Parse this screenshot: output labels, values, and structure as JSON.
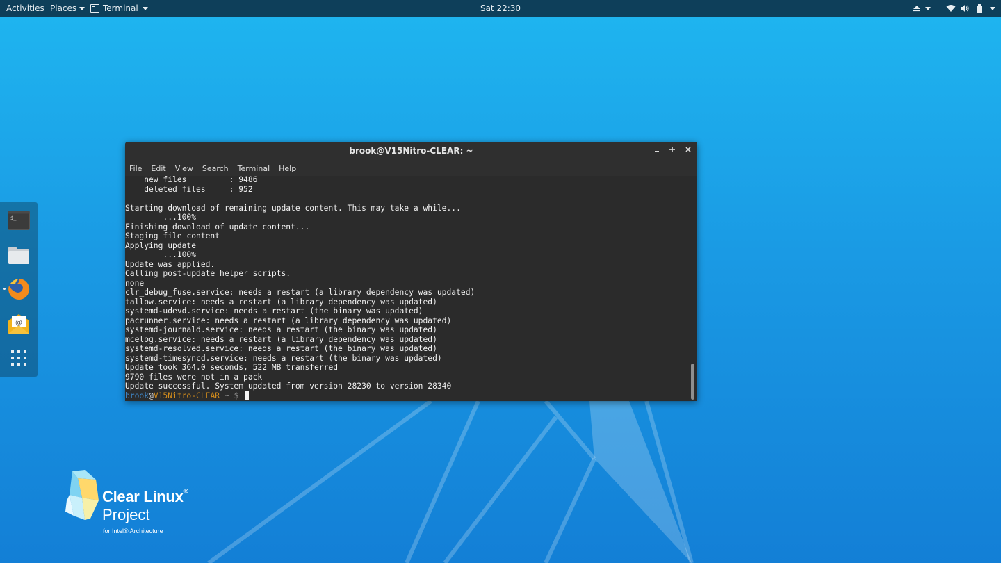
{
  "topbar": {
    "activities": "Activities",
    "places": "Places",
    "app_menu": "Terminal",
    "clock": "Sat 22:30",
    "tray_icons": [
      "eject-icon",
      "wifi-icon",
      "volume-icon",
      "battery-icon",
      "power-menu-icon"
    ]
  },
  "dock": {
    "items": [
      {
        "name": "terminal",
        "icon": "terminal-icon"
      },
      {
        "name": "files",
        "icon": "folder-icon"
      },
      {
        "name": "firefox",
        "icon": "firefox-icon",
        "running": true
      },
      {
        "name": "mail",
        "icon": "mail-icon"
      },
      {
        "name": "show-applications",
        "icon": "app-grid-icon"
      }
    ]
  },
  "window": {
    "title": "brook@V15Nitro-CLEAR: ~",
    "menu": [
      "File",
      "Edit",
      "View",
      "Search",
      "Terminal",
      "Help"
    ],
    "lines": [
      "    new files         : 9486",
      "    deleted files     : 952",
      "",
      "Starting download of remaining update content. This may take a while...",
      "        ...100%",
      "Finishing download of update content...",
      "Staging file content",
      "Applying update",
      "        ...100%",
      "Update was applied.",
      "Calling post-update helper scripts.",
      "none",
      "clr_debug_fuse.service: needs a restart (a library dependency was updated)",
      "tallow.service: needs a restart (a library dependency was updated)",
      "systemd-udevd.service: needs a restart (the binary was updated)",
      "pacrunner.service: needs a restart (a library dependency was updated)",
      "systemd-journald.service: needs a restart (the binary was updated)",
      "mcelog.service: needs a restart (a library dependency was updated)",
      "systemd-resolved.service: needs a restart (the binary was updated)",
      "systemd-timesyncd.service: needs a restart (the binary was updated)",
      "Update took 364.0 seconds, 522 MB transferred",
      "9790 files were not in a pack",
      "Update successful. System updated from version 28230 to version 28340"
    ],
    "prompt": {
      "user": "brook",
      "at": "@",
      "host": "V15Nitro-CLEAR",
      "rest": " ~ $ "
    }
  },
  "logo": {
    "line1": "Clear Linux",
    "registered": "®",
    "line2": "Project",
    "line3": "for Intel® Architecture"
  },
  "colors": {
    "topbar": "#0e3f5a",
    "desktop_top": "#1fb6f0",
    "desktop_bottom": "#137fd6",
    "terminal_bg": "#2b2b2b",
    "prompt_user": "#3f86c6",
    "prompt_host": "#d48d1c"
  }
}
